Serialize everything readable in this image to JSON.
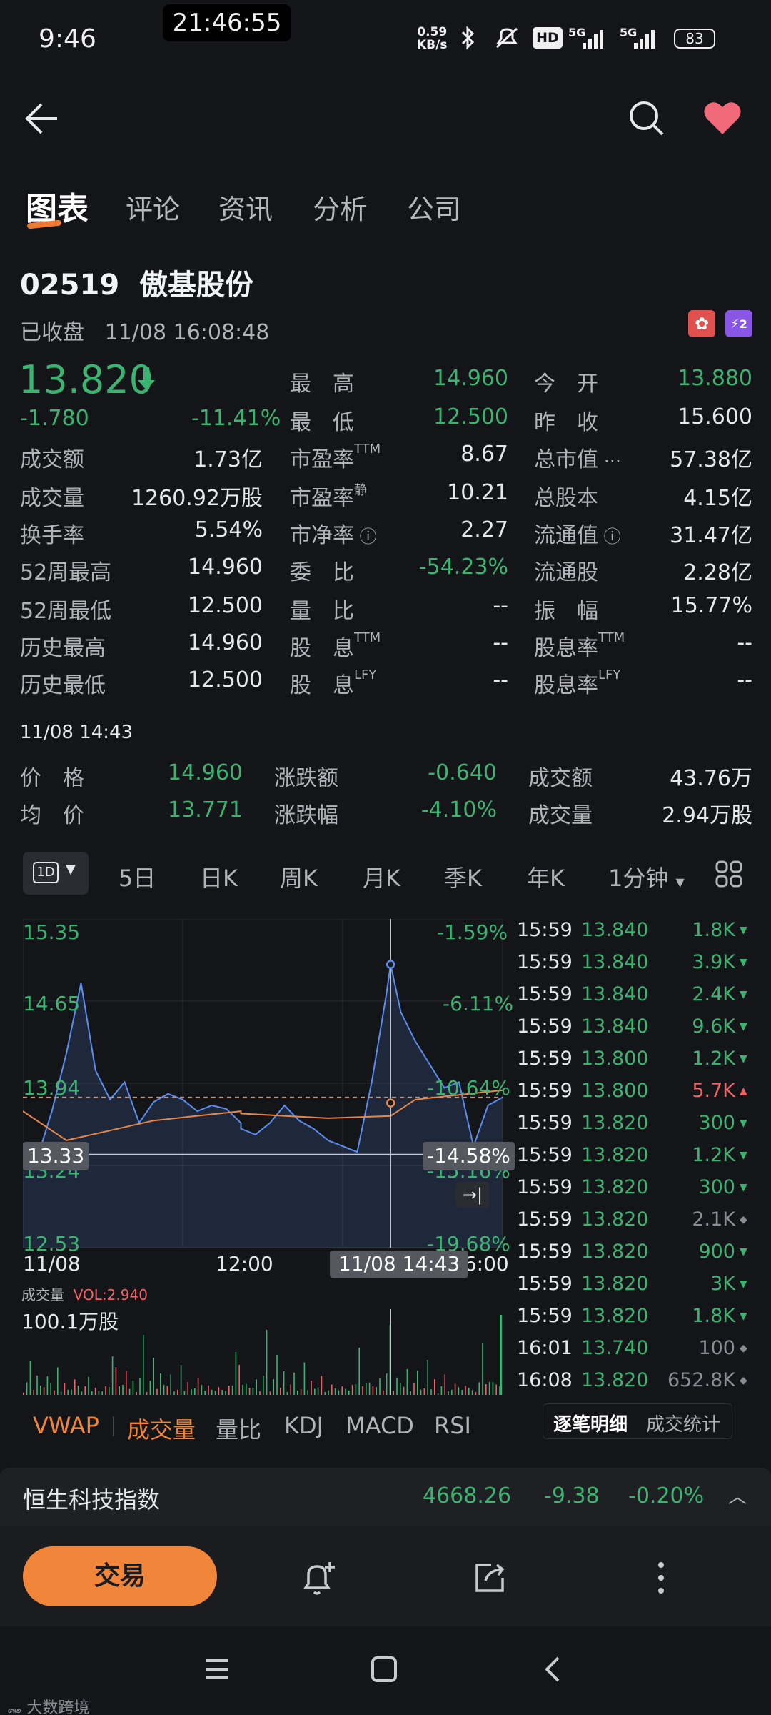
{
  "status_bar": {
    "time": "9:46",
    "recording_time": "21:46:55",
    "net_speed_value": "0.59",
    "net_speed_unit": "KB/s",
    "hd_label": "HD",
    "signal1": "5G",
    "signal2": "5G",
    "battery": "83"
  },
  "tabs": [
    "图表",
    "评论",
    "资讯",
    "分析",
    "公司"
  ],
  "stock": {
    "code": "02519",
    "name": "傲基股份",
    "status": "已收盘",
    "datetime": "11/08 16:08:48",
    "badge_l2": "2",
    "price": "13.820",
    "change": "-1.780",
    "change_pct": "-11.41%"
  },
  "quote": {
    "high_label": "最　高",
    "high": "14.960",
    "open_label": "今　开",
    "open": "13.880",
    "low_label": "最　低",
    "low": "12.500",
    "prev_label": "昨　收",
    "prev": "15.600",
    "rows": [
      {
        "l1": "成交额",
        "v1": "1.73亿",
        "l2": "市盈率",
        "s2": "TTM",
        "v2": "8.67",
        "l3": "总市值",
        "v3": "57.38亿"
      },
      {
        "l1": "成交量",
        "v1": "1260.92万股",
        "l2": "市盈率",
        "s2": "静",
        "v2": "10.21",
        "l3": "总股本",
        "v3": "4.15亿"
      },
      {
        "l1": "换手率",
        "v1": "5.54%",
        "l2": "市净率",
        "s2": "",
        "v2": "2.27",
        "l3": "流通值",
        "v3": "31.47亿"
      },
      {
        "l1": "52周最高",
        "v1": "14.960",
        "l2": "委　比",
        "s2": "",
        "v2": "-54.23%",
        "l3": "流通股",
        "v3": "2.28亿"
      },
      {
        "l1": "52周最低",
        "v1": "12.500",
        "l2": "量　比",
        "s2": "",
        "v2": "--",
        "l3": "振　幅",
        "v3": "15.77%"
      },
      {
        "l1": "历史最高",
        "v1": "14.960",
        "l2": "股　息",
        "s2": "TTM",
        "v2": "--",
        "l3": "股息率",
        "s3": "TTM",
        "v3": "--"
      },
      {
        "l1": "历史最低",
        "v1": "12.500",
        "l2": "股　息",
        "s2": "LFY",
        "v2": "--",
        "l3": "股息率",
        "s3": "LFY",
        "v3": "--"
      }
    ]
  },
  "tick": {
    "time": "11/08 14:43",
    "price_label": "价　格",
    "price": "14.960",
    "chg_label": "涨跌额",
    "chg": "-0.640",
    "amt_label": "成交额",
    "amt": "43.76万",
    "avg_label": "均　价",
    "avg": "13.771",
    "pct_label": "涨跌幅",
    "pct": "-4.10%",
    "vol_label": "成交量",
    "vol": "2.94万股"
  },
  "periods": [
    "1D",
    "5日",
    "日K",
    "周K",
    "月K",
    "季K",
    "年K",
    "1分钟"
  ],
  "chart": {
    "y_labels": [
      "15.35",
      "14.65",
      "13.94",
      "13.24",
      "12.53"
    ],
    "pct_labels": [
      "-1.59%",
      "-6.11%",
      "-10.64%",
      "-15.16%",
      "-19.68%"
    ],
    "cursor_price": "13.33",
    "cursor_pct": "-14.58%",
    "x_labels": [
      "11/08",
      "12:00",
      "16:00"
    ],
    "cursor_time": "11/08 14:43",
    "vol_title": "成交量",
    "vol_value": "VOL:2.940",
    "vol_max": "100.1万股"
  },
  "chart_data": {
    "type": "line",
    "title": "",
    "ylim": [
      12.53,
      15.35
    ],
    "series": [
      {
        "x": [
          "09:30",
          "09:40",
          "09:50",
          "10:00",
          "10:10",
          "10:20",
          "10:30",
          "10:40",
          "10:50",
          "11:00",
          "11:10",
          "11:20",
          "11:30",
          "11:40",
          "11:50",
          "12:00",
          "13:00",
          "13:10",
          "13:20",
          "13:30",
          "13:40",
          "13:50",
          "14:00",
          "14:10",
          "14:20",
          "14:30",
          "14:40",
          "14:43",
          "14:50",
          "15:00",
          "15:10",
          "15:20",
          "15:30",
          "15:40",
          "15:50",
          "16:00"
        ],
        "values": [
          13.4,
          13.3,
          13.7,
          14.2,
          14.8,
          14.05,
          13.8,
          13.95,
          13.6,
          13.78,
          13.85,
          13.8,
          13.7,
          13.75,
          13.72,
          13.6,
          13.55,
          13.5,
          13.6,
          13.75,
          13.62,
          13.55,
          13.45,
          13.4,
          13.35,
          13.95,
          14.7,
          14.96,
          14.55,
          14.3,
          14.1,
          13.9,
          13.95,
          13.4,
          13.75,
          13.82
        ]
      },
      {
        "x": [
          "09:30",
          "10:00",
          "11:00",
          "12:00",
          "13:00",
          "14:00",
          "14:43",
          "15:00",
          "16:00"
        ],
        "values": [
          13.7,
          13.45,
          13.62,
          13.7,
          13.68,
          13.64,
          13.66,
          13.8,
          13.88
        ]
      }
    ]
  },
  "trades": [
    {
      "t": "15:59",
      "p": "13.840",
      "v": "1.8K",
      "d": "down"
    },
    {
      "t": "15:59",
      "p": "13.840",
      "v": "3.9K",
      "d": "down"
    },
    {
      "t": "15:59",
      "p": "13.840",
      "v": "2.4K",
      "d": "down"
    },
    {
      "t": "15:59",
      "p": "13.840",
      "v": "9.6K",
      "d": "down"
    },
    {
      "t": "15:59",
      "p": "13.800",
      "v": "1.2K",
      "d": "down"
    },
    {
      "t": "15:59",
      "p": "13.800",
      "v": "5.7K",
      "d": "up"
    },
    {
      "t": "15:59",
      "p": "13.820",
      "v": "300",
      "d": "down"
    },
    {
      "t": "15:59",
      "p": "13.820",
      "v": "1.2K",
      "d": "down"
    },
    {
      "t": "15:59",
      "p": "13.820",
      "v": "300",
      "d": "down"
    },
    {
      "t": "15:59",
      "p": "13.820",
      "v": "2.1K",
      "d": "neutral"
    },
    {
      "t": "15:59",
      "p": "13.820",
      "v": "900",
      "d": "down"
    },
    {
      "t": "15:59",
      "p": "13.820",
      "v": "3K",
      "d": "down"
    },
    {
      "t": "15:59",
      "p": "13.820",
      "v": "1.8K",
      "d": "down"
    },
    {
      "t": "16:01",
      "p": "13.740",
      "v": "100",
      "d": "neutral"
    },
    {
      "t": "16:08",
      "p": "13.820",
      "v": "652.8K",
      "d": "neutral"
    }
  ],
  "indicators": [
    "VWAP",
    "成交量",
    "量比",
    "KDJ",
    "MACD",
    "RSI"
  ],
  "detail_tabs": [
    "逐笔明细",
    "成交统计"
  ],
  "index": {
    "name": "恒生科技指数",
    "value": "4668.26",
    "change": "-9.38",
    "pct": "-0.20%"
  },
  "bottom": {
    "trade": "交易"
  },
  "watermark": "大数跨境",
  "colors": {
    "green": "#3cb371",
    "red": "#ef5f63",
    "accent": "#f1853a",
    "line": "#5b8def",
    "vwap": "#e8874a"
  }
}
